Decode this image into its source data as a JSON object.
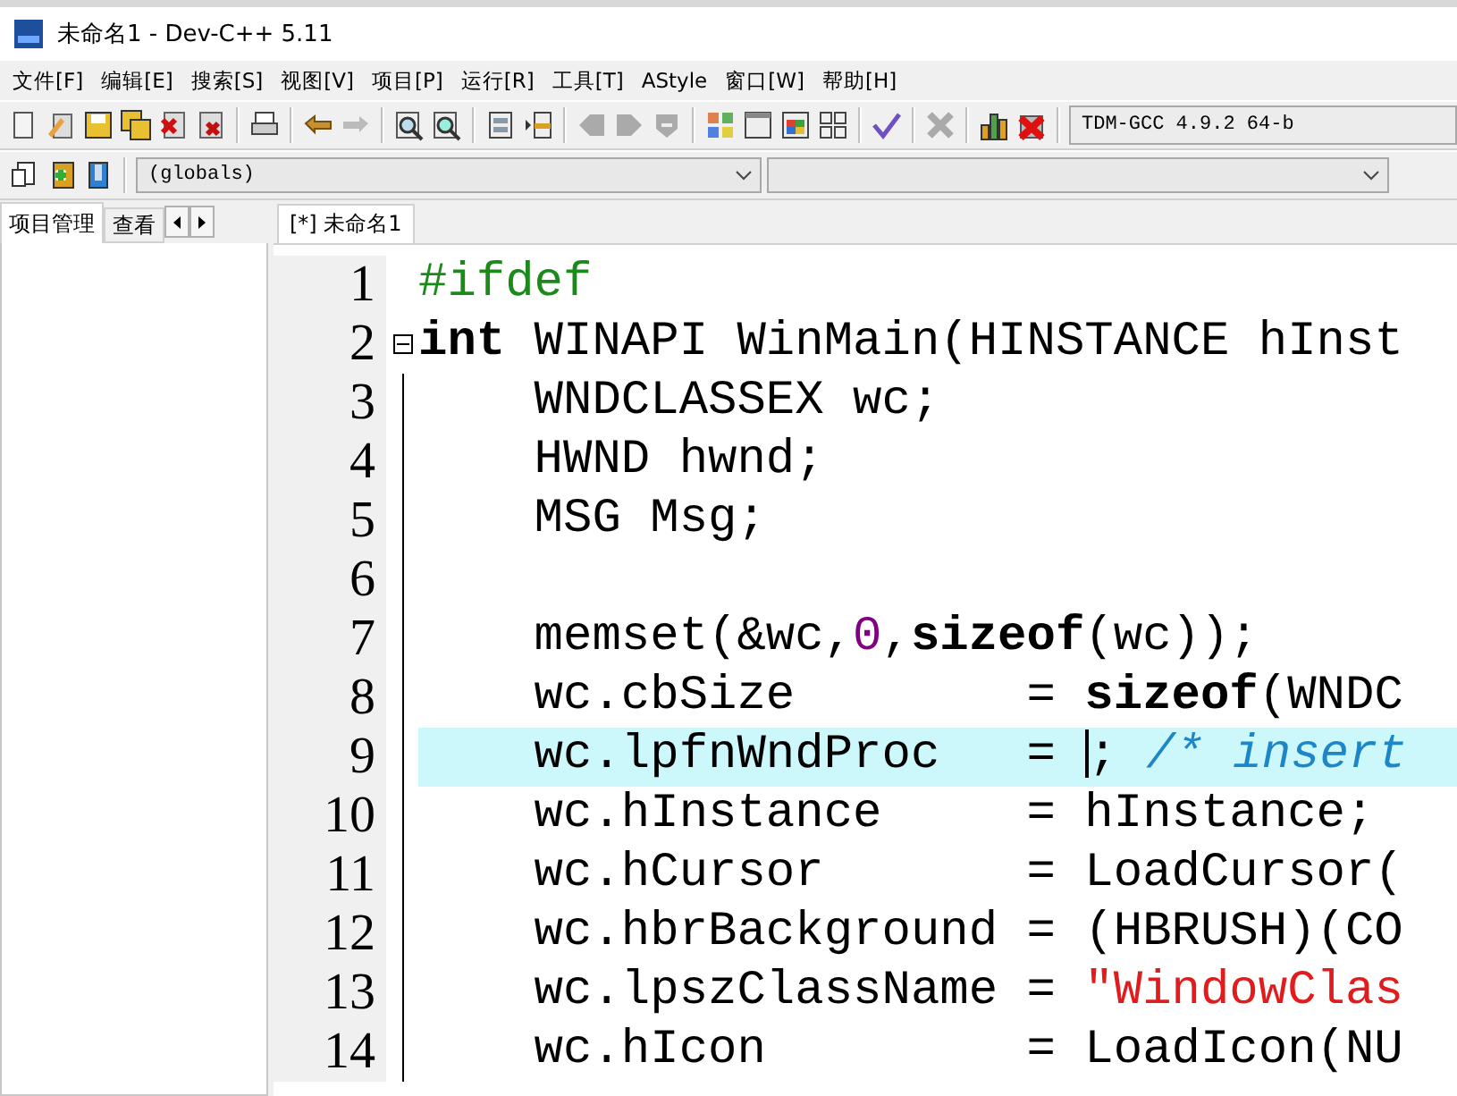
{
  "window": {
    "title": "未命名1 - Dev-C++ 5.11"
  },
  "menu": [
    "文件[F]",
    "编辑[E]",
    "搜索[S]",
    "视图[V]",
    "项目[P]",
    "运行[R]",
    "工具[T]",
    "AStyle",
    "窗口[W]",
    "帮助[H]"
  ],
  "compiler_select": {
    "value": "TDM-GCC 4.9.2 64-b"
  },
  "scope_select": {
    "value": "(globals)"
  },
  "side_tabs": [
    {
      "label": "项目管理",
      "selected": true
    },
    {
      "label": "查看",
      "selected": false
    }
  ],
  "editor_tabs": [
    {
      "label": "[*] 未命名1",
      "selected": true
    }
  ],
  "lines": [
    {
      "number": "1",
      "fold": false,
      "current": false,
      "segments": [
        {
          "kind": "preproc",
          "text": "#ifdef"
        }
      ]
    },
    {
      "number": "2",
      "fold": true,
      "current": false,
      "segments": [
        {
          "kind": "keyword",
          "text": "int"
        },
        {
          "kind": "plain",
          "text": " WINAPI WinMain(HINSTANCE hInst"
        }
      ]
    },
    {
      "number": "3",
      "fold": false,
      "current": false,
      "segments": [
        {
          "kind": "plain",
          "text": "    WNDCLASSEX wc;"
        }
      ]
    },
    {
      "number": "4",
      "fold": false,
      "current": false,
      "segments": [
        {
          "kind": "plain",
          "text": "    HWND hwnd;"
        }
      ]
    },
    {
      "number": "5",
      "fold": false,
      "current": false,
      "segments": [
        {
          "kind": "plain",
          "text": "    MSG Msg;"
        }
      ]
    },
    {
      "number": "6",
      "fold": false,
      "current": false
    },
    {
      "number": "7",
      "fold": false,
      "current": false,
      "segments": [
        {
          "kind": "plain",
          "text": "    memset(&wc,"
        },
        {
          "kind": "number",
          "text": "0"
        },
        {
          "kind": "plain",
          "text": ","
        },
        {
          "kind": "keyword",
          "text": "sizeof"
        },
        {
          "kind": "plain",
          "text": "(wc));"
        }
      ]
    },
    {
      "number": "8",
      "fold": false,
      "current": false,
      "segments": [
        {
          "kind": "plain",
          "text": "    wc.cbSize        = "
        },
        {
          "kind": "keyword",
          "text": "sizeof"
        },
        {
          "kind": "plain",
          "text": "(WNDC"
        }
      ]
    },
    {
      "number": "9",
      "fold": false,
      "current": true,
      "segments": [
        {
          "kind": "plain",
          "text": "    wc.lpfnWndProc   = "
        },
        {
          "kind": "caret"
        },
        {
          "kind": "plain",
          "text": "; "
        },
        {
          "kind": "comment",
          "text": "/* insert"
        }
      ]
    },
    {
      "number": "10",
      "fold": false,
      "current": false,
      "segments": [
        {
          "kind": "plain",
          "text": "    wc.hInstance     = hInstance;"
        }
      ]
    },
    {
      "number": "11",
      "fold": false,
      "current": false,
      "segments": [
        {
          "kind": "plain",
          "text": "    wc.hCursor       = LoadCursor("
        }
      ]
    },
    {
      "number": "12",
      "fold": false,
      "current": false,
      "segments": [
        {
          "kind": "plain",
          "text": "    wc.hbrBackground = (HBRUSH)(CO"
        }
      ]
    },
    {
      "number": "13",
      "fold": false,
      "current": false,
      "segments": [
        {
          "kind": "plain",
          "text": "    wc.lpszClassName = "
        },
        {
          "kind": "string",
          "text": "\"WindowClas"
        }
      ]
    },
    {
      "number": "14",
      "fold": false,
      "current": false,
      "segments": [
        {
          "kind": "plain",
          "text": "    wc.hIcon         = LoadIcon(NU"
        }
      ]
    }
  ]
}
